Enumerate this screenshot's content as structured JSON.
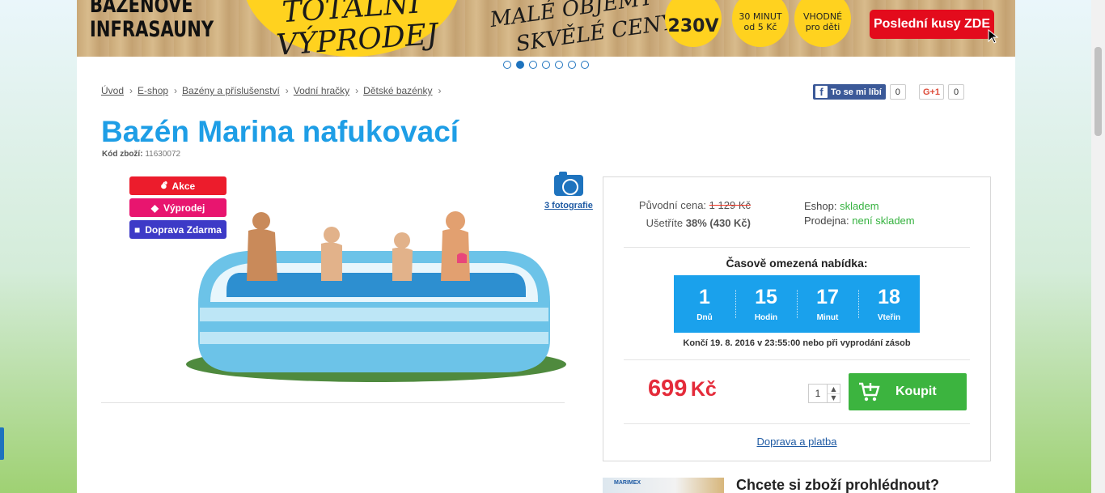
{
  "banner": {
    "left_text": "BAZÉNOVÉ INFRASAUNY",
    "left_line1": "BAZÉNOVÉ",
    "left_line2": "INFRASAUNY",
    "circle_line1": "TOTÁLNÍ",
    "circle_line2": "VÝPRODEJ",
    "mid_line1": "MALÉ OBJEMY",
    "mid_line2": "SKVĚLÉ CENY",
    "badge1": "230V",
    "badge2_line1": "30 MINUT",
    "badge2_line2": "od 5 Kč",
    "badge3_line1": "VHODNÉ",
    "badge3_line2": "pro děti",
    "cta": "Poslední kusy ZDE",
    "slides": 7,
    "active_slide": 2
  },
  "breadcrumb": {
    "items": [
      "Úvod",
      "E-shop",
      "Bazény a příslušenství",
      "Vodní hračky",
      "Dětské bazénky"
    ]
  },
  "social": {
    "fb_label": "To se mi líbí",
    "fb_count": "0",
    "gplus_label": "G+1",
    "gplus_count": "0"
  },
  "product": {
    "title": "Bazén Marina nafukovací",
    "code_label": "Kód zboží:",
    "code": "11630072",
    "labels": [
      "Akce",
      "Výprodej",
      "Doprava Zdarma"
    ],
    "photos_link": "3 fotografie"
  },
  "pricing": {
    "original_label": "Původní cena:",
    "original_price": "1 129 Kč",
    "save_label": "Ušetříte",
    "save_value": "38% (430 Kč)",
    "eshop_label": "Eshop:",
    "eshop_status": "skladem",
    "store_label": "Prodejna:",
    "store_status": "není skladem",
    "offer_title": "Časově omezená nabídka:",
    "countdown": [
      {
        "value": "1",
        "label": "Dnů"
      },
      {
        "value": "15",
        "label": "Hodin"
      },
      {
        "value": "17",
        "label": "Minut"
      },
      {
        "value": "18",
        "label": "Vteřin"
      }
    ],
    "ends_text": "Končí 19. 8. 2016 v 23:55:00 nebo při vyprodání zásob",
    "price": "699",
    "currency": "Kč",
    "qty": "1",
    "buy_label": "Koupit",
    "transport_link": "Doprava a platba"
  },
  "bottom": {
    "thumb_text": "MARIMEX",
    "title": "Chcete si zboží prohlédnout?"
  },
  "colors": {
    "accent_blue": "#1e9ee6",
    "price_red": "#e42b3a",
    "buy_green": "#3cb43f",
    "countdown_blue": "#1aa1ec"
  }
}
